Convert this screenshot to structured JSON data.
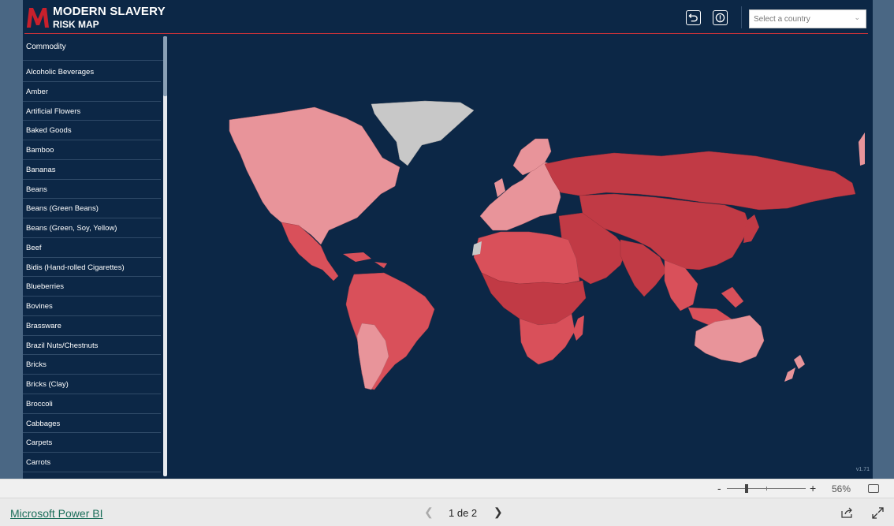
{
  "header": {
    "title_line1": "MODERN SLAVERY",
    "title_line2": "RISK MAP",
    "country_placeholder": "Select a country",
    "reset_icon": "undo-icon",
    "info_icon": "info-icon"
  },
  "commodity": {
    "heading": "Commodity",
    "items": [
      "Alcoholic Beverages",
      "Amber",
      "Artificial Flowers",
      "Baked Goods",
      "Bamboo",
      "Bananas",
      "Beans",
      "Beans (Green Beans)",
      "Beans (Green, Soy, Yellow)",
      "Beef",
      "Bidis (Hand-rolled Cigarettes)",
      "Blueberries",
      "Bovines",
      "Brassware",
      "Brazil Nuts/Chestnuts",
      "Bricks",
      "Bricks (Clay)",
      "Broccoli",
      "Cabbages",
      "Carpets",
      "Carrots"
    ]
  },
  "map": {
    "version": "v1.71",
    "colors": {
      "background": "#0c2746",
      "low_risk": "#e8949a",
      "medium_risk": "#d9505a",
      "high_risk": "#c13a45",
      "no_data": "#c8c8c8"
    }
  },
  "zoom": {
    "minus": "-",
    "plus": "+",
    "percent": "56%",
    "level": 0.25
  },
  "footer": {
    "brand": "Microsoft Power BI",
    "page_indicator": "1 de 2",
    "prev_icon": "chevron-left-icon",
    "next_icon": "chevron-right-icon",
    "share_icon": "share-icon",
    "fullscreen_icon": "expand-icon"
  }
}
